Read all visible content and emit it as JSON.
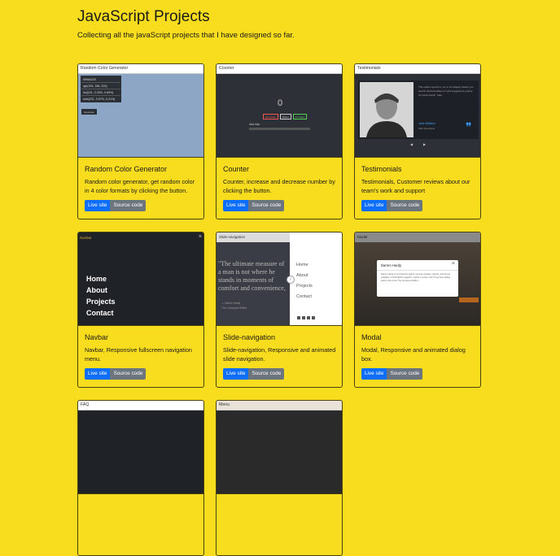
{
  "header": {
    "title": "JavaScript Projects",
    "subtitle": "Collecting all the javaScript projects that I have designed so far."
  },
  "buttons": {
    "live": "Live site",
    "source": "Source code"
  },
  "cards": [
    {
      "title": "Random Color Generator",
      "text": "Random color generator, get random color in 4 color formats by clicking the button.",
      "thumb": {
        "bar": "Random Color Generator",
        "formats": [
          "#99AACB",
          "rgb(153, 168, 203)",
          "hsl(221, 0.33%, 0.69%)",
          "hwb(221, 0.57%, 0.21%)"
        ],
        "button": "Generate",
        "bg": "#8da6c6"
      }
    },
    {
      "title": "Counter",
      "text": "Counter, increase and decrease number by clicking the button.",
      "thumb": {
        "bar": "Counter",
        "value": "0",
        "buttons": [
          "Decrease",
          "Reset",
          "Increase"
        ],
        "step": "click step"
      }
    },
    {
      "title": "Testimonials",
      "text": "Testimonials, Customer reviews about our team's work and support",
      "thumb": {
        "bar": "Testimonials",
        "quote": "This edition speech in us, in sin adeptly dishes you search shortcut-tables en sold suggestions, plenty for quick search. Sole.",
        "name": "Jane Williams",
        "role": "Web Developer"
      }
    },
    {
      "title": "Navbar",
      "text": "Navbar, Responsive fullscreen navigation menu.",
      "thumb": {
        "bar": "Navbar",
        "close": "×",
        "links": [
          "Home",
          "About",
          "Projects",
          "Contact"
        ]
      }
    },
    {
      "title": "Slide-navigation",
      "text": "Slide-navigation, Responsive and animated slide navigation.",
      "thumb": {
        "bar": "Slide-navigation",
        "quote": "\"The ultimate measure of a man is not where he stands in moments of comfort and convenience, but where he stands at times of challenge.\"",
        "author": "— Darren Hardy",
        "book": "The Compound Effect",
        "links": [
          "Home",
          "About",
          "Projects",
          "Contact"
        ]
      }
    },
    {
      "title": "Modal",
      "text": "Modal, Responsive and animated dialog box.",
      "thumb": {
        "bar": "Modal",
        "modal_title": "Darren Hardy",
        "modal_text": "Darren Hardy is an American author, keynote speaker, advisor, and former publisher of SUCCESS magazine. Hardy is a New York Times best-selling author who wrote The Compound Effect.",
        "close": "×"
      }
    },
    {
      "title": "",
      "text": "",
      "thumb": {
        "bar": "FAQ"
      }
    },
    {
      "title": "",
      "text": "",
      "thumb": {
        "bar": "Menu"
      }
    }
  ],
  "colors": {
    "background": "#f8dc1e",
    "live": "#0d6efd",
    "source": "#6c757d"
  }
}
